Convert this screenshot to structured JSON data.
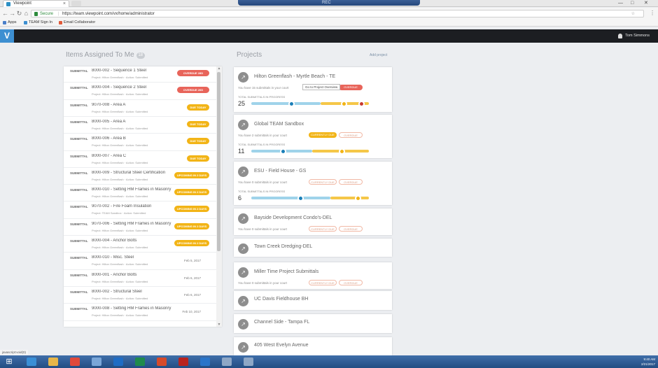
{
  "browser": {
    "tab_title": "Viewpoint",
    "tab_close": "×",
    "window_center_text": "REC",
    "controls": [
      "—",
      "□",
      "✕"
    ],
    "nav": {
      "back": "←",
      "forward": "→",
      "reload": "↻",
      "home": "⌂"
    },
    "secure_label": "Secure",
    "url": "https://team.viewpoint.com/vx/home/administrator",
    "star": "☆",
    "menu": "⋮",
    "bookmarks": [
      {
        "label": "Apps",
        "color": "#4a7fc9"
      },
      {
        "label": "TEAM Sign In",
        "color": "#3d8fd1"
      },
      {
        "label": "Email Collaborator",
        "color": "#e05a3a"
      }
    ]
  },
  "app": {
    "logo": "V",
    "user_name": "Tom Simmons"
  },
  "items_section": {
    "heading": "Items Assigned To Me",
    "count": "18"
  },
  "items": [
    {
      "type": "SUBMITTAL",
      "title": "8000-002 - Sequence 1 Steel",
      "meta": "Project: Hilton Greenflash  ·  Action: Submitted",
      "badge": "OVERDUE 28D",
      "badge_color": "red"
    },
    {
      "type": "SUBMITTAL",
      "title": "8000-004 - Sequence 2 Steel",
      "meta": "Project: Hilton Greenflash  ·  Action: Submitted",
      "badge": "OVERDUE 26D",
      "badge_color": "red"
    },
    {
      "type": "SUBMITTAL",
      "title": "9070-008 - Area A",
      "meta": "Project: Hilton Greenflash  ·  Action: Submitted",
      "badge": "DUE TODAY",
      "badge_color": "yellow"
    },
    {
      "type": "SUBMITTAL",
      "title": "8000-005 - Area A",
      "meta": "Project: Hilton Greenflash  ·  Action: Submitted",
      "badge": "DUE TODAY",
      "badge_color": "yellow"
    },
    {
      "type": "SUBMITTAL",
      "title": "8000-006 - Area B",
      "meta": "Project: Hilton Greenflash  ·  Action: Submitted",
      "badge": "DUE TODAY",
      "badge_color": "yellow"
    },
    {
      "type": "SUBMITTAL",
      "title": "8000-007 - Area C",
      "meta": "Project: Hilton Greenflash  ·  Action: Submitted",
      "badge": "DUE TODAY",
      "badge_color": "yellow"
    },
    {
      "type": "SUBMITTAL",
      "title": "8000-009 - Structural Steel Certification",
      "meta": "Project: Hilton Greenflash  ·  Action: Submitted",
      "badge": "UPCOMING IN 2 DAYS",
      "badge_color": "yellow"
    },
    {
      "type": "SUBMITTAL",
      "title": "8000-010 - Setting HM Frames in Masonry",
      "meta": "Project: Hilton Greenflash  ·  Action: Submitted",
      "badge": "UPCOMING IN 2 DAYS",
      "badge_color": "yellow"
    },
    {
      "type": "SUBMITTAL",
      "title": "9070-002 - Fire Foam Insulation",
      "meta": "Project: TEAM Sandbox  ·  Action: Submitted",
      "badge": "UPCOMING IN 2 DAYS",
      "badge_color": "yellow"
    },
    {
      "type": "SUBMITTAL",
      "title": "9070-006 - Setting HM Frames in Masonry",
      "meta": "Project: Hilton Greenflash  ·  Action: Submitted",
      "badge": "UPCOMING IN 2 DAYS",
      "badge_color": "yellow"
    },
    {
      "type": "SUBMITTAL",
      "title": "8000-004 - Anchor Bolts",
      "meta": "Project: Hilton Greenflash  ·  Action: Submitted",
      "badge": "UPCOMING IN 2 DAYS",
      "badge_color": "yellow"
    },
    {
      "type": "SUBMITTAL",
      "title": "8000-010 - Misc. Steel",
      "meta": "Project: Hilton Greenflash  ·  Action: Submitted",
      "date": "Feb 5, 2017"
    },
    {
      "type": "SUBMITTAL",
      "title": "8000-001 - Anchor Bolts",
      "meta": "Project: Hilton Greenflash  ·  Action: Submitted",
      "date": "Feb 6, 2017"
    },
    {
      "type": "SUBMITTAL",
      "title": "8000-002 - Structural Steel",
      "meta": "Project: Hilton Greenflash  ·  Action: Submitted",
      "date": "Feb 6, 2017"
    },
    {
      "type": "SUBMITTAL",
      "title": "9000-008 - Setting HM Frames in Masonry",
      "meta": "Project: Hilton Greenflash  ·  Action: Submitted",
      "date": "Feb 10, 2017"
    }
  ],
  "projects_section": {
    "heading": "Projects",
    "add_label": "Add project"
  },
  "projects": [
    {
      "name": "Hilton Greenflash - Myrtle Beach - TE",
      "subtitle": "You have 15 submittals in your court",
      "pills": [
        {
          "label": "OVERDUE",
          "style": "solid-red"
        }
      ],
      "total_label": "TOTAL SUBMITTALS IN PROGRESS",
      "total": "25",
      "markers": {
        "blue": 0.34,
        "yellow": 0.79,
        "red": 0.94
      }
    },
    {
      "name": "Global TEAM Sandbox",
      "subtitle": "You have 2 submittals in your court",
      "pills": [
        {
          "label": "CURRENTLY DUE",
          "style": "solid-yellow"
        },
        {
          "label": "OVERDUE",
          "style": "outline"
        }
      ],
      "total_label": "TOTAL SUBMITTALS IN PROGRESS",
      "total": "11",
      "markers": {
        "blue": 0.27,
        "yellow": 0.77
      }
    },
    {
      "name": "ESU - Field House - GS",
      "subtitle": "You have 0 submittals in your court",
      "pills": [
        {
          "label": "CURRENTLY DUE",
          "style": "outline"
        },
        {
          "label": "OVERDUE",
          "style": "outline"
        }
      ],
      "total_label": "TOTAL SUBMITTALS IN PROGRESS",
      "total": "6",
      "markers": {
        "blue": 0.42,
        "yellow": 0.91
      }
    },
    {
      "name": "Bayside Development Condo's-DEL",
      "subtitle": "You have 0 submittals in your court",
      "pills": [
        {
          "label": "CURRENTLY DUE",
          "style": "outline"
        },
        {
          "label": "OVERDUE",
          "style": "outline"
        }
      ]
    },
    {
      "name": "Town Creek Dredging-DEL"
    },
    {
      "name": "Miller Time Project Submittals",
      "subtitle": "You have 0 submittals in your court",
      "pills": [
        {
          "label": "CURRENTLY DUE",
          "style": "outline"
        },
        {
          "label": "OVERDUE",
          "style": "outline"
        }
      ]
    },
    {
      "name": "UC Davis Fieldhouse BH"
    },
    {
      "name": "Channel Side - Tampa FL"
    },
    {
      "name": "405 West Evelyn Avenue"
    }
  ],
  "tooltip": "Go to Project Overview",
  "status_url": "javascript:void(0)",
  "taskbar": {
    "start": "⊞",
    "apps": [
      {
        "name": "ie-icon",
        "color": "#3a8fd6"
      },
      {
        "name": "explorer-icon",
        "color": "#e6b64a"
      },
      {
        "name": "chrome-icon",
        "color": "#e0493b"
      },
      {
        "name": "pen-icon",
        "color": "#7aa6d8"
      },
      {
        "name": "outlook-icon",
        "color": "#1f6cc4"
      },
      {
        "name": "excel-icon",
        "color": "#1f8a4c"
      },
      {
        "name": "powerpoint-icon",
        "color": "#d54a2b"
      },
      {
        "name": "acrobat-icon",
        "color": "#b8231f"
      },
      {
        "name": "outlook2-icon",
        "color": "#2a74c9"
      },
      {
        "name": "viewpoint-icon",
        "color": "#8ea7c6"
      },
      {
        "name": "viewpoint2-icon",
        "color": "#8ea7c6"
      }
    ],
    "time": "9:40 AM",
    "date": "2/21/2017"
  }
}
